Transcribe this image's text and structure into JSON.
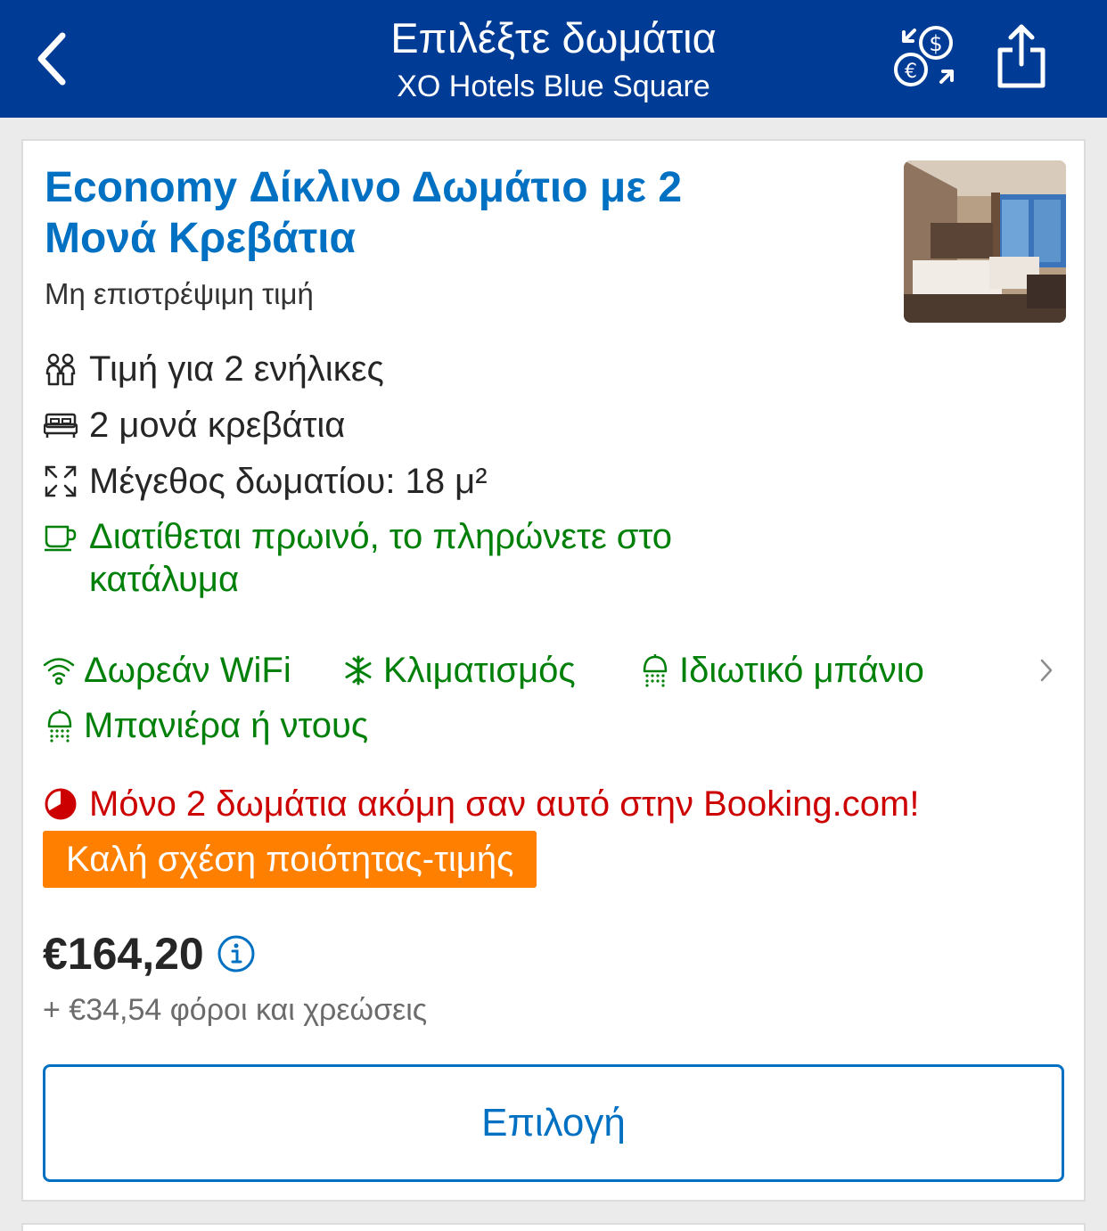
{
  "header": {
    "title": "Επιλέξτε δωμάτια",
    "subtitle": "XO Hotels Blue Square",
    "background": "#003b95",
    "icons": [
      "back-chevron-icon",
      "currency-exchange-icon",
      "share-icon"
    ]
  },
  "room": {
    "title": "Economy Δίκλινο Δωμάτιο με 2 Μονά Κρεβάτια",
    "refund_policy": "Μη επιστρέψιμη τιμή",
    "features": {
      "adults": "Τιμή για 2 ενήλικες",
      "beds": "2 μονά κρεβάτια",
      "size": "Μέγεθος δωματίου: 18 μ²",
      "breakfast": "Διατίθεται πρωινό, το πληρώνετε στο κατάλυμα"
    },
    "amenities": {
      "wifi": "Δωρεάν WiFi",
      "ac": "Κλιματισμός",
      "bathroom": "Ιδιωτικό μπάνιο",
      "shower": "Μπανιέρα ή ντους"
    },
    "scarcity": "Μόνο 2 δωμάτια ακόμη σαν αυτό στην Booking.com!",
    "value_badge": "Καλή σχέση ποιότητας-τιμής",
    "price": "€164,20",
    "taxes": "+ €34,54 φόροι και χρεώσεις",
    "select_label": "Επιλογή"
  },
  "colors": {
    "link_blue": "#0071c2",
    "green": "#008009",
    "red": "#cc0000",
    "orange": "#ff8000"
  }
}
